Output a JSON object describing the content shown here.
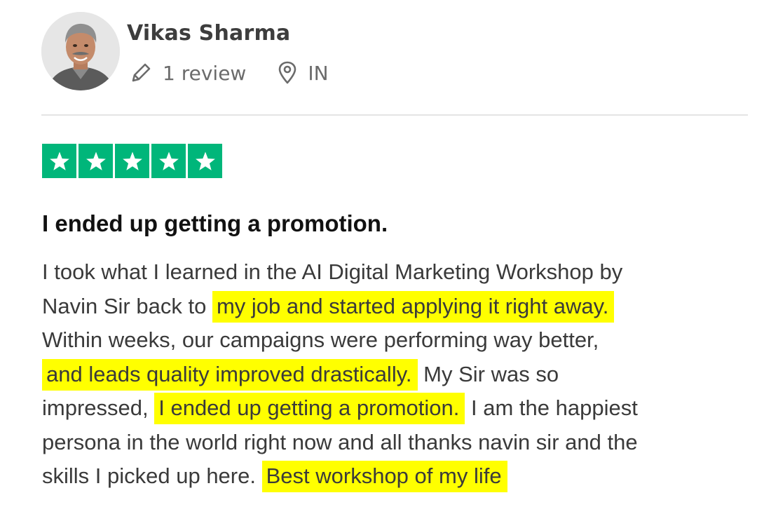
{
  "reviewer": {
    "name": "Vikas Sharma",
    "review_count": "1 review",
    "country": "IN"
  },
  "rating": {
    "stars": 5,
    "max": 5,
    "color": "#00b67a"
  },
  "review": {
    "title": "I ended up getting a promotion.",
    "line1": "I took what I learned in the AI Digital Marketing Workshop by",
    "line2_plain": "Navin Sir back to",
    "line2_highlight": "my job and started applying it right away.",
    "line3": "Within weeks, our campaigns were performing way better,",
    "line4_highlight": "and leads quality improved drastically.",
    "line4_plain": "My Sir was so",
    "line5_plain_a": "impressed,",
    "line5_highlight": "I ended up getting a promotion.",
    "line5_plain_b": "I am the happiest",
    "line6": "persona in the world right now and all thanks navin sir and the",
    "line7_plain": "skills I picked up here.",
    "line7_highlight": "Best workshop of my life"
  },
  "colors": {
    "highlight": "#ffff00",
    "star_green": "#00b67a",
    "name_text": "#3d3d3d",
    "meta_text": "#6b6b6b",
    "divider": "#e4e4e4"
  },
  "icons": [
    "avatar-photo",
    "pencil-icon",
    "location-pin-icon",
    "star-icon"
  ]
}
